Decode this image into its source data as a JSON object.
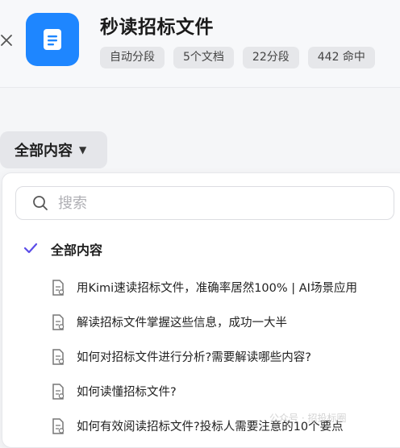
{
  "header": {
    "title": "秒读招标文件",
    "tags": [
      "自动分段",
      "5个文档",
      "22分段",
      "442 命中"
    ]
  },
  "filter": {
    "label": "全部内容"
  },
  "dropdown": {
    "search_placeholder": "搜索",
    "all_option": "全部内容",
    "documents": [
      "用Kimi速读招标文件，准确率居然100% | AI场景应用",
      "解读招标文件掌握这些信息，成功一大半",
      "如何对招标文件进行分析?需要解读哪些内容?",
      "如何读懂招标文件?",
      "如何有效阅读招标文件?投标人需要注意的10个要点"
    ]
  },
  "watermark": "公众号 · 招投标圈",
  "colors": {
    "accent_blue": "#1e86ff",
    "check_purple": "#5b4de8"
  }
}
